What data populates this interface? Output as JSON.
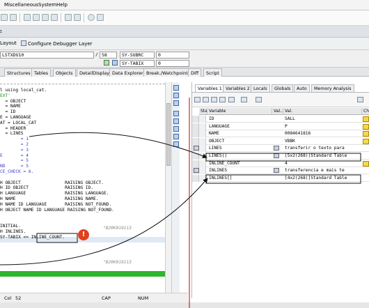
{
  "menu": {
    "items": [
      "Miscellaneous",
      "System",
      "Help"
    ]
  },
  "screen_title": ":",
  "app_toolbar": {
    "layout_label": "Layout",
    "configure_label": "Configure Debugger Layer"
  },
  "info": {
    "program": "LSTXDU10",
    "slash": "/",
    "line_no": "58",
    "field1_name": "SY-SUBRC",
    "field1_value": "0",
    "field2_name": "SY-TABIX",
    "field2_value": "0"
  },
  "tabs": [
    "Structures",
    "Tables",
    "Objects",
    "DetailDisplay",
    "Data Explorer",
    "Break./Watchpoints",
    "Diff",
    "Script"
  ],
  "code_lines": [
    {
      "text": "l using local_cat.",
      "color": "#000000"
    },
    {
      "text": "EXT'",
      "color": "#1a8a1a"
    },
    {
      "text": "  = OBJECT",
      "color": "#000000"
    },
    {
      "text": "  = NAME",
      "color": "#000000"
    },
    {
      "text": "  = ID",
      "color": "#000000"
    },
    {
      "text": "E = LANGUAGE",
      "color": "#000000"
    },
    {
      "text": "AT = LOCAL_CAT",
      "color": "#000000"
    },
    {
      "text": "  = HEADER",
      "color": "#000000"
    },
    {
      "text": "  = LINES",
      "color": "#000000"
    },
    {
      "text": "        = 1",
      "color": "#3a3ad0"
    },
    {
      "text": "        = 2",
      "color": "#3a3ad0"
    },
    {
      "text": "        = 3",
      "color": "#3a3ad0"
    },
    {
      "text": "E       = 4",
      "color": "#3a3ad0"
    },
    {
      "text": "        = 5",
      "color": "#3a3ad0"
    },
    {
      "text": "ND      = 5",
      "color": "#3a3ad0"
    },
    {
      "text": "CE_CHECK = 6.",
      "color": "#3a3ad0"
    },
    {
      "text": "",
      "color": "#000000"
    },
    {
      "text": "H OBJECT                 RAISING OBJECT.",
      "color": "#000000"
    },
    {
      "text": "H ID OBJECT              RAISING ID.",
      "color": "#000000"
    },
    {
      "text": "H LANGUAGE               RAISING LANGUAGE.",
      "color": "#000000"
    },
    {
      "text": "H NAME                   RAISING NAME.",
      "color": "#000000"
    },
    {
      "text": "H NAME ID LANGUAGE       RAISING NOT_FOUND.",
      "color": "#000000"
    },
    {
      "text": "H OBJECT NAME ID LANGUAGE RAISING NOT_FOUND.",
      "color": "#000000"
    },
    {
      "text": "",
      "color": "#000000"
    },
    {
      "text": "",
      "color": "#000000"
    },
    {
      "text": "INITIAL.",
      "color": "#000000"
    },
    {
      "text": "H INLINES.",
      "color": "#000000"
    },
    {
      "text": "SY-TABIX <= INLINE_COUNT.",
      "color": "#000000"
    }
  ],
  "code_comments": {
    "c1": "\"B20K019113",
    "c2": "\"B20K019113"
  },
  "right_tabs": [
    "Variables 1",
    "Variables 2",
    "Locals",
    "Globals",
    "Auto",
    "Memory Analysis"
  ],
  "columns": {
    "st": "Sta...",
    "variable": "Variable",
    "val1": "Val...",
    "val": "Val.",
    "ch": "Ch..."
  },
  "variables": [
    {
      "name": "ID",
      "value": "SALL",
      "editable": true,
      "type_icon": false,
      "table_icon": false
    },
    {
      "name": "LANGUAGE",
      "value": "P",
      "editable": true,
      "type_icon": false,
      "table_icon": false
    },
    {
      "name": "NAME",
      "value": "0084641816",
      "editable": true,
      "type_icon": false,
      "table_icon": false
    },
    {
      "name": "OBJECT",
      "value": "VBBK",
      "editable": true,
      "type_icon": false,
      "table_icon": false
    },
    {
      "name": "LINES",
      "value": "  transferir o texto para",
      "editable": false,
      "type_icon": true,
      "table_icon": true
    },
    {
      "name": "LINES[]",
      "value": "[5x2(268)]Standard Table",
      "editable": false,
      "type_icon": true,
      "table_icon": false
    },
    {
      "name": "INLINE_COUNT",
      "value": "4",
      "editable": true,
      "type_icon": false,
      "table_icon": false
    },
    {
      "name": "INLINES",
      "value": "  transferencia e mais te",
      "editable": false,
      "type_icon": true,
      "table_icon": true
    },
    {
      "name": "INLINES[]",
      "value": "[4x2(268)]Standard Table",
      "editable": false,
      "type_icon": false,
      "table_icon": false
    }
  ],
  "status": {
    "col": "Col",
    "col_value": "52",
    "cap": "CAP",
    "num": "NUM"
  },
  "colors": {
    "accent_green": "#2fb52f",
    "highlight_line": "#dfe9f6",
    "arrow_red": "#c00000",
    "stop_icon": "#e0401f"
  }
}
